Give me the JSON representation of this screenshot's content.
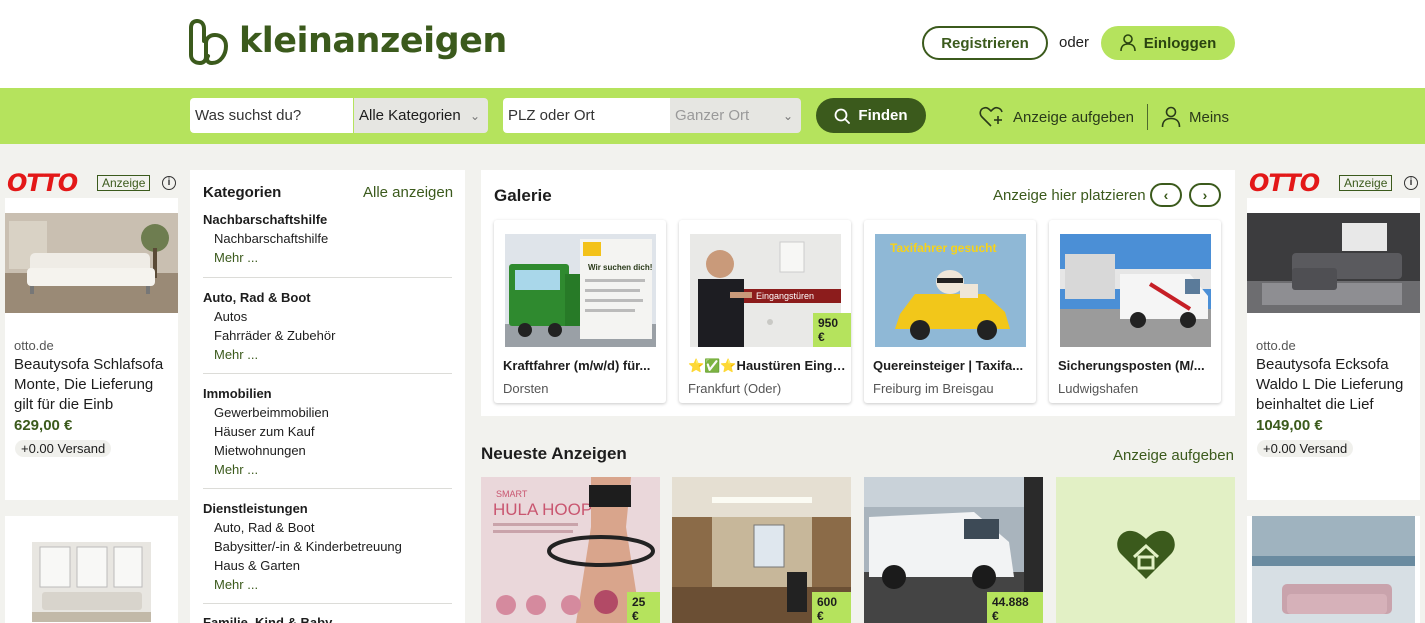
{
  "header": {
    "logo_text": "kleinanzeigen",
    "register_label": "Registrieren",
    "or_text": "oder",
    "login_label": "Einloggen"
  },
  "search": {
    "query_placeholder": "Was suchst du?",
    "category_value": "Alle Kategorien",
    "location_placeholder": "PLZ oder Ort",
    "radius_value": "Ganzer Ort",
    "find_label": "Finden",
    "post_ad_label": "Anzeige aufgeben",
    "account_label": "Meins"
  },
  "left_ad": {
    "brand": "OTTO",
    "ad_label": "Anzeige",
    "source": "otto.de",
    "title": "Beautysofa Schlafsofa Monte, Die Lieferung gilt für die Einb",
    "price": "629,00 €",
    "shipping": "+0.00 Versand"
  },
  "right_ad": {
    "brand": "OTTO",
    "ad_label": "Anzeige",
    "source": "otto.de",
    "title": "Beautysofa Ecksofa Waldo L Die Lieferung beinhaltet die Lief",
    "price": "1049,00 €",
    "shipping": "+0.00 Versand"
  },
  "categories": {
    "heading": "Kategorien",
    "all_label": "Alle anzeigen",
    "more_label": "Mehr ...",
    "groups": [
      {
        "title": "Nachbarschaftshilfe",
        "items": [
          "Nachbarschaftshilfe"
        ]
      },
      {
        "title": "Auto, Rad & Boot",
        "items": [
          "Autos",
          "Fahrräder & Zubehör"
        ]
      },
      {
        "title": "Immobilien",
        "items": [
          "Gewerbeimmobilien",
          "Häuser zum Kauf",
          "Mietwohnungen"
        ]
      },
      {
        "title": "Dienstleistungen",
        "items": [
          "Auto, Rad & Boot",
          "Babysitter/-in & Kinderbetreuung",
          "Haus & Garten"
        ]
      },
      {
        "title": "Familie, Kind & Baby",
        "items": []
      }
    ]
  },
  "gallery": {
    "heading": "Galerie",
    "place_ad_label": "Anzeige hier platzieren",
    "items": [
      {
        "title": "Kraftfahrer (m/w/d) für...",
        "location": "Dorsten",
        "price": ""
      },
      {
        "title": "⭐✅⭐Haustüren Einga...",
        "location": "Frankfurt (Oder)",
        "price": "950 €"
      },
      {
        "title": "Quereinsteiger | Taxifa...",
        "location": "Freiburg im Breisgau",
        "price": ""
      },
      {
        "title": "Sicherungsposten (M/...",
        "location": "Ludwigshafen",
        "price": ""
      }
    ],
    "image_texts": {
      "truck_sign": "Wir suchen dich!",
      "door_sign": "Eingangstüren",
      "taxi_sign": "Taxifahrer gesucht",
      "hula_brand": "SMART",
      "hula_title": "HULA HOOP"
    }
  },
  "newest": {
    "heading": "Neueste Anzeigen",
    "post_label": "Anzeige aufgeben",
    "items": [
      {
        "price": "25 €"
      },
      {
        "price": "600 €"
      },
      {
        "price": "44.888 €"
      },
      {
        "price": ""
      }
    ]
  },
  "colors": {
    "brand_green": "#3b5a1c",
    "lime": "#b5e35d",
    "otto_red": "#e31818"
  }
}
